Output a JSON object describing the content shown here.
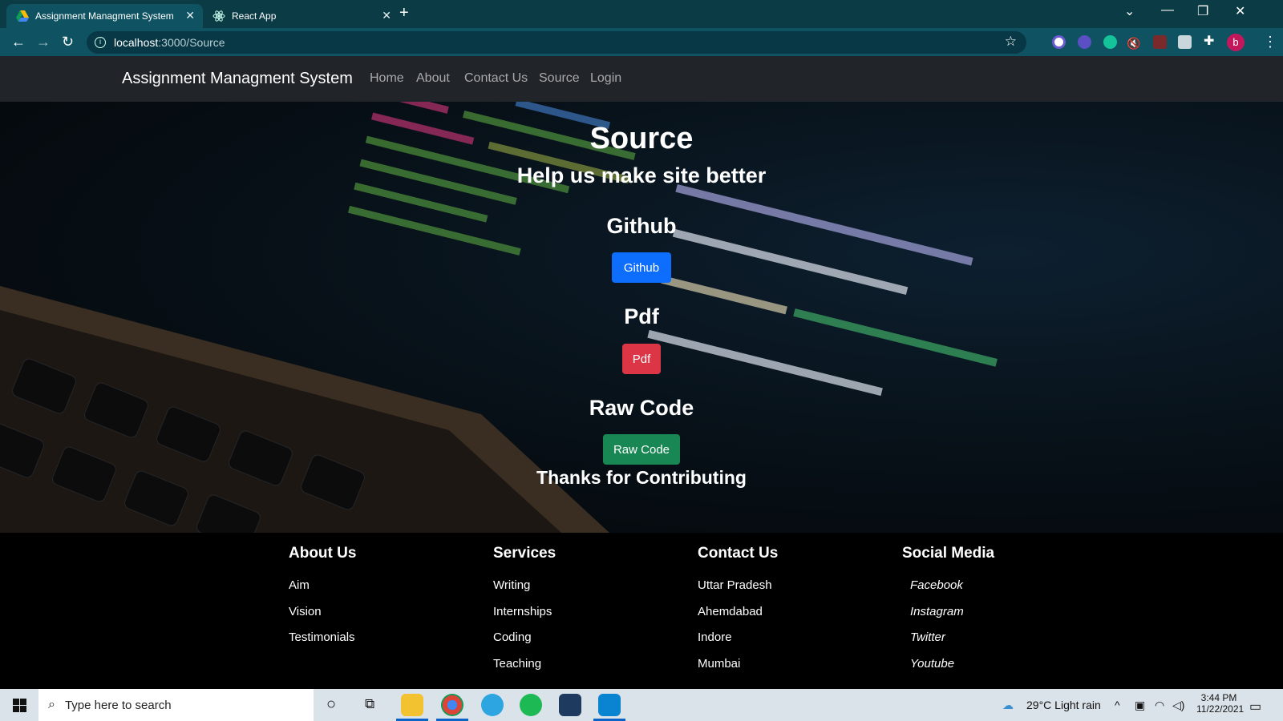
{
  "browser": {
    "tabs": [
      {
        "title": "Assignment Managment System",
        "active": true
      },
      {
        "title": "React App",
        "active": false
      }
    ],
    "url_host": "localhost",
    "url_path": ":3000/Source"
  },
  "navbar": {
    "brand": "Assignment Managment System",
    "links": [
      "Home",
      "About",
      "Contact Us",
      "Source",
      "Login"
    ]
  },
  "hero": {
    "title": "Source",
    "subtitle": "Help us make site better",
    "sections": [
      {
        "heading": "Github",
        "button": "Github",
        "color": "#0d6efd"
      },
      {
        "heading": "Pdf",
        "button": "Pdf",
        "color": "#dc3545"
      },
      {
        "heading": "Raw Code",
        "button": "Raw Code",
        "color": "#198754"
      }
    ],
    "closing": "Thanks for Contributing"
  },
  "footer": {
    "columns": [
      {
        "title": "About Us",
        "items": [
          "Aim",
          "Vision",
          "Testimonials"
        ]
      },
      {
        "title": "Services",
        "items": [
          "Writing",
          "Internships",
          "Coding",
          "Teaching"
        ]
      },
      {
        "title": "Contact Us",
        "items": [
          "Uttar Pradesh",
          "Ahemdabad",
          "Indore",
          "Mumbai"
        ]
      },
      {
        "title": "Social Media",
        "items": [
          "Facebook",
          "Instagram",
          "Twitter",
          "Youtube"
        ]
      }
    ]
  },
  "taskbar": {
    "search_placeholder": "Type here to search",
    "weather": "29°C  Light rain",
    "time": "3:44 PM",
    "date": "11/22/2021"
  },
  "avatar_letter": "b",
  "colors": {
    "titlebar": "#0b3b45",
    "addressbar": "#0f5261",
    "navbar": "#212529"
  }
}
